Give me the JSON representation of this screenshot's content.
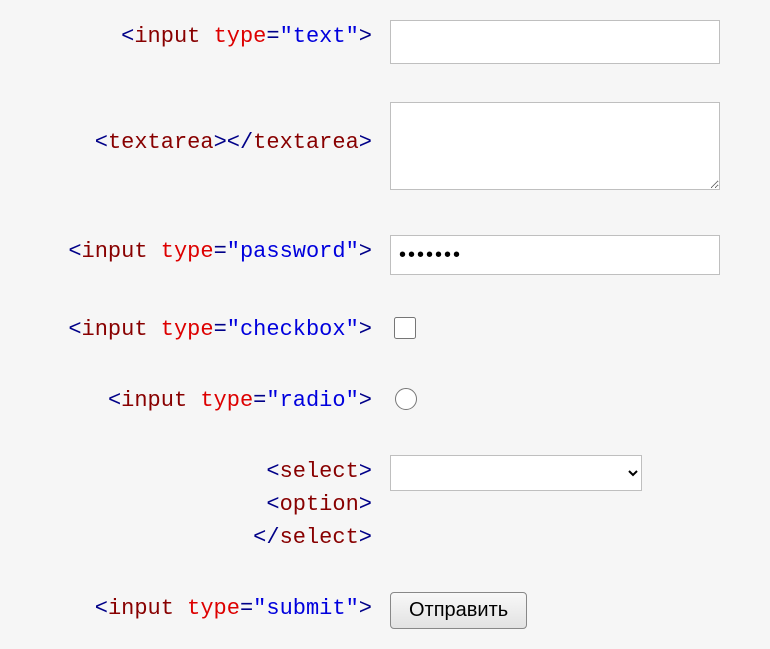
{
  "rows": {
    "text": {
      "tag": "input",
      "attr": "type",
      "val": "\"text\"",
      "value": ""
    },
    "textarea": {
      "open": "textarea",
      "close": "textarea",
      "value": ""
    },
    "password": {
      "tag": "input",
      "attr": "type",
      "val": "\"password\"",
      "value": "1234567"
    },
    "checkbox": {
      "tag": "input",
      "attr": "type",
      "val": "\"checkbox\""
    },
    "radio": {
      "tag": "input",
      "attr": "type",
      "val": "\"radio\""
    },
    "select": {
      "l1": "select",
      "l2": "option",
      "l3": "select",
      "value": ""
    },
    "submit": {
      "tag": "input",
      "attr": "type",
      "val": "\"submit\"",
      "button": "Отправить"
    }
  }
}
